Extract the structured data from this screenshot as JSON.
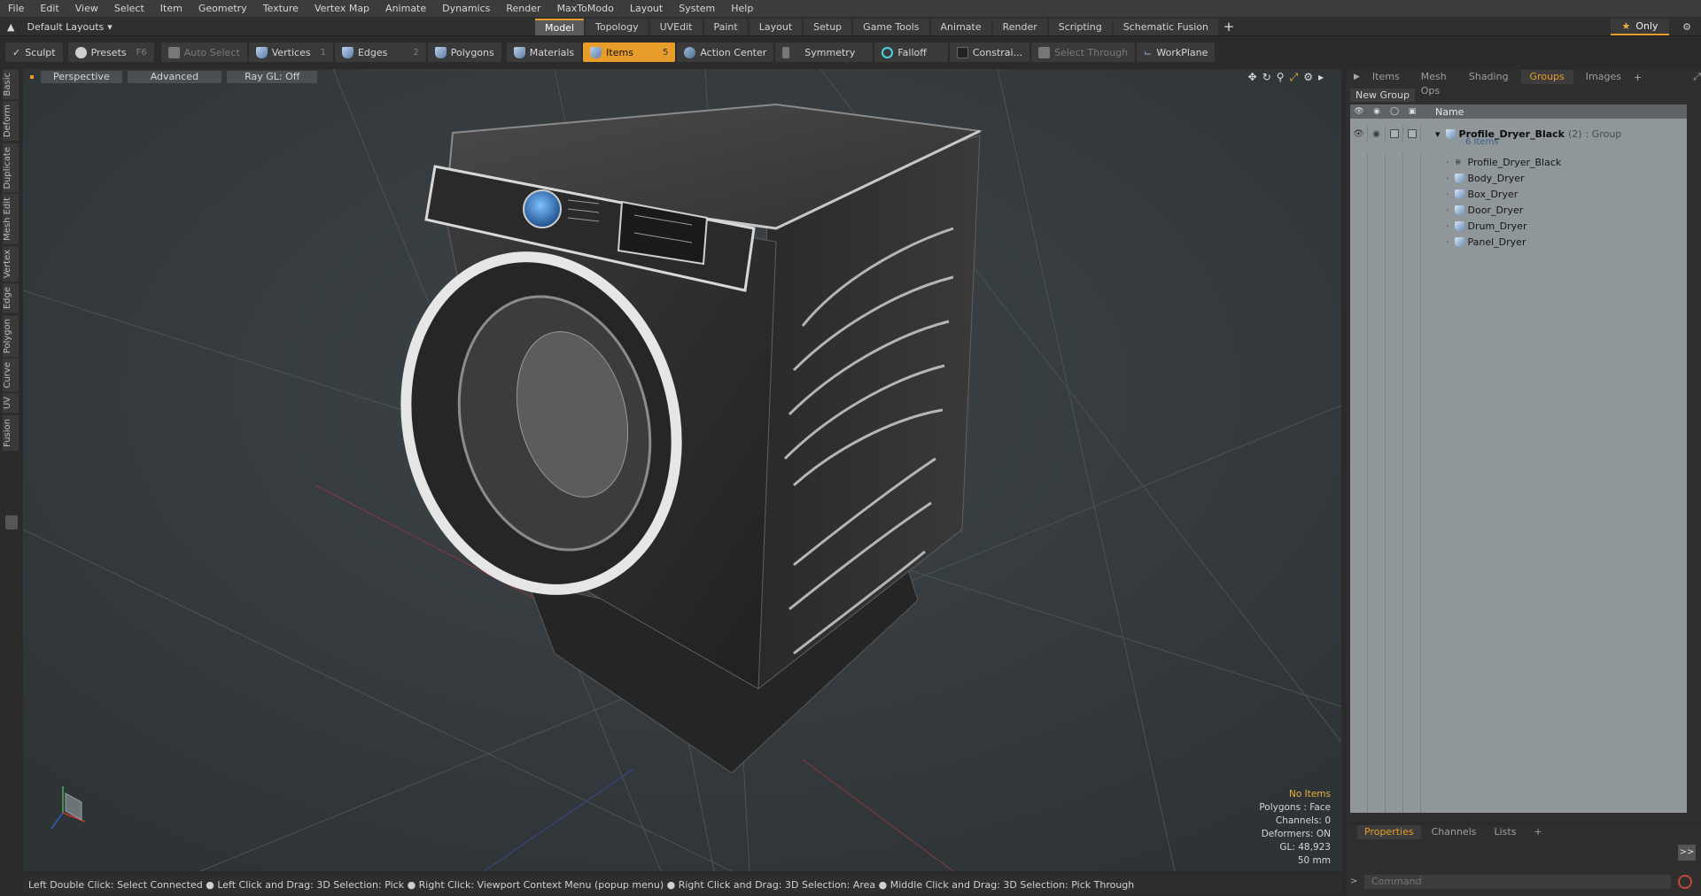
{
  "menu": [
    "File",
    "Edit",
    "View",
    "Select",
    "Item",
    "Geometry",
    "Texture",
    "Vertex Map",
    "Animate",
    "Dynamics",
    "Render",
    "MaxToModo",
    "Layout",
    "System",
    "Help"
  ],
  "layout_dropdown": "Default Layouts",
  "layout_tabs": [
    "Model",
    "Topology",
    "UVEdit",
    "Paint",
    "Layout",
    "Setup",
    "Game Tools",
    "Animate",
    "Render",
    "Scripting",
    "Schematic Fusion"
  ],
  "layout_active": "Model",
  "only_label": "Only",
  "toolbar": {
    "sculpt": "Sculpt",
    "presets": "Presets",
    "presets_key": "F6",
    "auto_select": "Auto Select",
    "vertices": "Vertices",
    "vertices_num": "1",
    "edges": "Edges",
    "edges_num": "2",
    "polygons": "Polygons",
    "materials": "Materials",
    "items": "Items",
    "items_num": "5",
    "action_center": "Action Center",
    "symmetry": "Symmetry",
    "falloff": "Falloff",
    "constraints": "Constrai...",
    "select_through": "Select Through",
    "workplane": "WorkPlane"
  },
  "left_tabs": [
    "Basic",
    "Deform",
    "Duplicate",
    "Mesh Edit",
    "Vertex",
    "Edge",
    "Polygon",
    "Curve",
    "UV",
    "Fusion"
  ],
  "viewport": {
    "view": "Perspective",
    "shading": "Advanced",
    "raygl": "Ray GL: Off",
    "stats": {
      "selection": "No Items",
      "polygons": "Polygons : Face",
      "channels": "Channels: 0",
      "deformers": "Deformers: ON",
      "gl": "GL: 48,923",
      "unit": "50 mm"
    }
  },
  "status_bar": "Left Double Click: Select Connected ● Left Click and Drag: 3D Selection: Pick ● Right Click: Viewport Context Menu (popup menu) ● Right Click and Drag: 3D Selection: Area ● Middle Click and Drag: 3D Selection: Pick Through",
  "right_panel": {
    "tabs": [
      "Items",
      "Mesh Ops",
      "Shading",
      "Groups",
      "Images"
    ],
    "active_tab": "Groups",
    "new_group": "New Group",
    "name_header": "Name",
    "group": {
      "name": "Profile_Dryer_Black",
      "count": "(2)",
      "type": ": Group",
      "items_label": "6 Items"
    },
    "children": [
      "Profile_Dryer_Black",
      "Body_Dryer",
      "Box_Dryer",
      "Door_Dryer",
      "Drum_Dryer",
      "Panel_Dryer"
    ]
  },
  "bottom_panel": {
    "tabs": [
      "Properties",
      "Channels",
      "Lists"
    ],
    "active_tab": "Properties",
    "command_placeholder": "Command"
  },
  "colors": {
    "accent": "#e89d2a",
    "viewport_bg": "#343a3d",
    "panel_list_bg": "#8f979a"
  }
}
